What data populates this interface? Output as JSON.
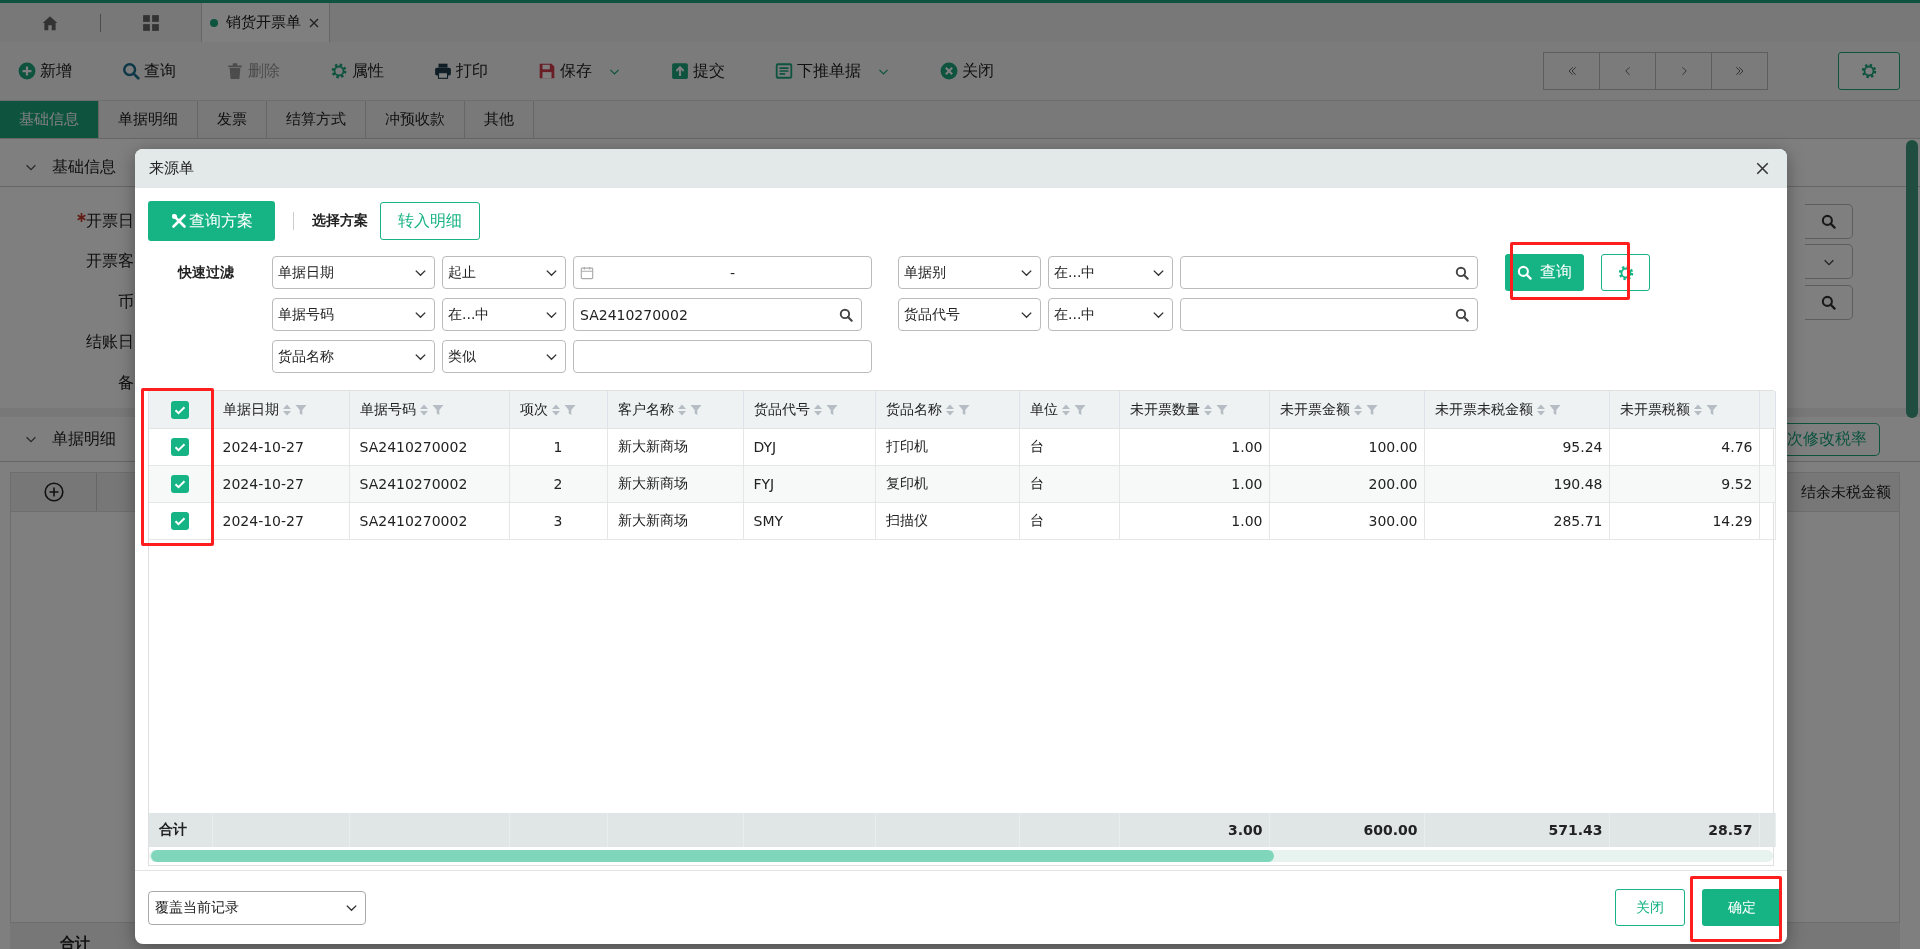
{
  "app_tabs": [
    {
      "label": "销货开票单"
    }
  ],
  "toolbar": [
    {
      "label": "新增",
      "kind": "plus",
      "disabled": false,
      "dropdown": false
    },
    {
      "label": "查询",
      "kind": "search",
      "disabled": false,
      "dropdown": false
    },
    {
      "label": "删除",
      "kind": "trash",
      "disabled": true,
      "dropdown": false
    },
    {
      "label": "属性",
      "kind": "gear",
      "disabled": false,
      "dropdown": false
    },
    {
      "label": "打印",
      "kind": "printer",
      "disabled": false,
      "dropdown": false
    },
    {
      "label": "保存",
      "kind": "save",
      "disabled": false,
      "dropdown": true
    },
    {
      "label": "提交",
      "kind": "upload",
      "disabled": false,
      "dropdown": false
    },
    {
      "label": "下推单据",
      "kind": "document",
      "disabled": false,
      "dropdown": true
    },
    {
      "label": "关闭",
      "kind": "close",
      "disabled": false,
      "dropdown": false
    }
  ],
  "form_tabs": [
    {
      "label": "基础信息",
      "selected": true
    },
    {
      "label": "单据明细",
      "selected": false
    },
    {
      "label": "发票",
      "selected": false
    },
    {
      "label": "结算方式",
      "selected": false
    },
    {
      "label": "冲预收款",
      "selected": false
    },
    {
      "label": "其他",
      "selected": false
    }
  ],
  "basic_section": {
    "title": "基础信息",
    "expanded": true,
    "fields": [
      {
        "label": "开票日",
        "required": true,
        "kind": "lookup"
      },
      {
        "label": "开票客",
        "required": false,
        "kind": "select"
      },
      {
        "label": "币",
        "required": false,
        "kind": "lookup"
      },
      {
        "label": "结账日",
        "required": false,
        "kind": "text"
      },
      {
        "label": "备",
        "required": false,
        "kind": "text"
      }
    ]
  },
  "detail_section": {
    "title": "单据明细",
    "expanded": true,
    "button": "次修改税率",
    "column": "结余未税金额",
    "total_label": "合计"
  },
  "dialog": {
    "title": "来源单",
    "scheme_button": "查询方案",
    "scheme_label": "选择方案",
    "transfer_button": "转入明细",
    "filter_label": "快速过滤",
    "filter_rows": [
      [
        {
          "field": "单据日期",
          "operator": "起止",
          "kind": "date-range",
          "separator": "-"
        },
        {
          "field": "单据别",
          "operator": "在...中",
          "kind": "search"
        }
      ],
      [
        {
          "field": "单据号码",
          "operator": "在...中",
          "kind": "search",
          "value": "SA2410270002"
        },
        {
          "field": "货品代号",
          "operator": "在...中",
          "kind": "search"
        }
      ],
      [
        {
          "field": "货品名称",
          "operator": "类似",
          "kind": "text"
        }
      ]
    ],
    "query_button": {
      "label": "查询",
      "highlighted": true
    },
    "table": {
      "all_checked": true,
      "checkbox_column_highlighted": true,
      "total_label": "合计",
      "columns": [
        {
          "label": "单据日期",
          "kind": "text"
        },
        {
          "label": "单据号码",
          "kind": "text"
        },
        {
          "label": "项次",
          "kind": "index"
        },
        {
          "label": "客户名称",
          "kind": "text"
        },
        {
          "label": "货品代号",
          "kind": "text"
        },
        {
          "label": "货品名称",
          "kind": "text"
        },
        {
          "label": "单位",
          "kind": "text"
        },
        {
          "label": "未开票数量",
          "kind": "number",
          "total": "3.00"
        },
        {
          "label": "未开票金额",
          "kind": "number",
          "total": "600.00"
        },
        {
          "label": "未开票未税金额",
          "kind": "number",
          "total": "571.43"
        },
        {
          "label": "未开票税额",
          "kind": "number",
          "total": "28.57"
        }
      ],
      "rows": [
        {
          "checked": true,
          "cells": [
            "2024-10-27",
            "SA2410270002",
            "1",
            "新大新商场",
            "DYJ",
            "打印机",
            "台",
            "1.00",
            "100.00",
            "95.24",
            "4.76"
          ]
        },
        {
          "checked": true,
          "cells": [
            "2024-10-27",
            "SA2410270002",
            "2",
            "新大新商场",
            "FYJ",
            "复印机",
            "台",
            "1.00",
            "200.00",
            "190.48",
            "9.52"
          ]
        },
        {
          "checked": true,
          "cells": [
            "2024-10-27",
            "SA2410270002",
            "3",
            "新大新商场",
            "SMY",
            "扫描仪",
            "台",
            "1.00",
            "300.00",
            "285.71",
            "14.29"
          ]
        }
      ]
    },
    "write_mode": "覆盖当前记录",
    "close_button": {
      "label": "关闭"
    },
    "confirm_button": {
      "label": "确定",
      "highlighted": true
    }
  }
}
